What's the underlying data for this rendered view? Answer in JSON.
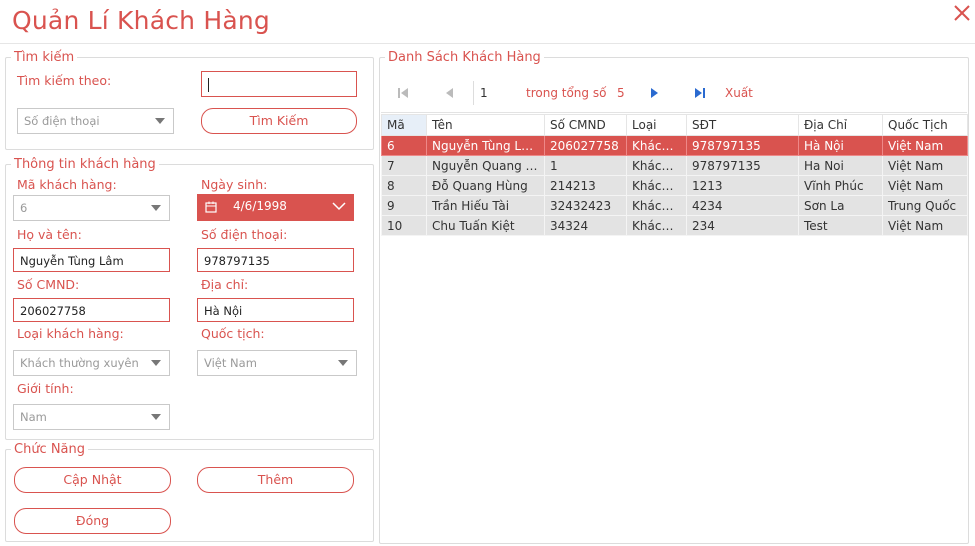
{
  "window": {
    "title": "Quản Lí Khách Hàng"
  },
  "search": {
    "legend": "Tìm kiếm",
    "by_label": "Tìm kiếm theo:",
    "input_value": "",
    "field_combo": "Số điện thoại",
    "button": "Tìm Kiếm"
  },
  "info": {
    "legend": "Thông tin khách hàng",
    "id_label": "Mã khách hàng:",
    "id_value": "6",
    "dob_label": "Ngày sinh:",
    "dob_value": "4/6/1998",
    "name_label": "Họ và tên:",
    "name_value": "Nguyễn Tùng Lâm",
    "phone_label": "Số điện thoại:",
    "phone_value": "978797135",
    "cmnd_label": "Số CMND:",
    "cmnd_value": "206027758",
    "address_label": "Địa chỉ:",
    "address_value": "Hà Nội",
    "type_label": "Loại khách hàng:",
    "type_value": "Khách thường xuyên",
    "nation_label": "Quốc tịch:",
    "nation_value": "Việt Nam",
    "gender_label": "Giới tính:",
    "gender_value": "Nam"
  },
  "actions": {
    "legend": "Chức Năng",
    "update": "Cập Nhật",
    "add": "Thêm",
    "close": "Đóng"
  },
  "list": {
    "legend": "Danh Sách Khách Hàng",
    "nav": {
      "page": "1",
      "of_label": "trong tổng số",
      "total": "5",
      "export": "Xuất"
    },
    "columns": [
      "Mã",
      "Tên",
      "Số CMND",
      "Loại",
      "SĐT",
      "Địa Chỉ",
      "Quốc Tịch"
    ],
    "rows": [
      [
        "6",
        "Nguyễn Tùng Lâm",
        "206027758",
        "Khách th...",
        "978797135",
        "Hà Nội",
        "Việt Nam"
      ],
      [
        "7",
        "Nguyễn Quang Sang",
        "1",
        "Khách th...",
        "978797135",
        "Ha Noi",
        "Việt Nam"
      ],
      [
        "8",
        "Đỗ Quang Hùng",
        "214213",
        "Khách th...",
        "1213",
        "Vĩnh Phúc",
        "Việt Nam"
      ],
      [
        "9",
        "Trần Hiếu Tài",
        "32432423",
        "Khách th...",
        "4234",
        "Sơn La",
        "Trung Quốc"
      ],
      [
        "10",
        "Chu Tuấn Kiệt",
        "34324",
        "Khách th...",
        "234",
        "Test",
        "Việt Nam"
      ]
    ],
    "selected_row": 0
  },
  "colors": {
    "accent": "#d9534f",
    "row_bg": "#e3e3e3",
    "header_sel": "#e7eff8"
  },
  "icons": [
    "close-icon",
    "calendar-icon",
    "chevron-down-icon",
    "first-page-icon",
    "prev-page-icon",
    "next-page-icon",
    "last-page-icon"
  ]
}
